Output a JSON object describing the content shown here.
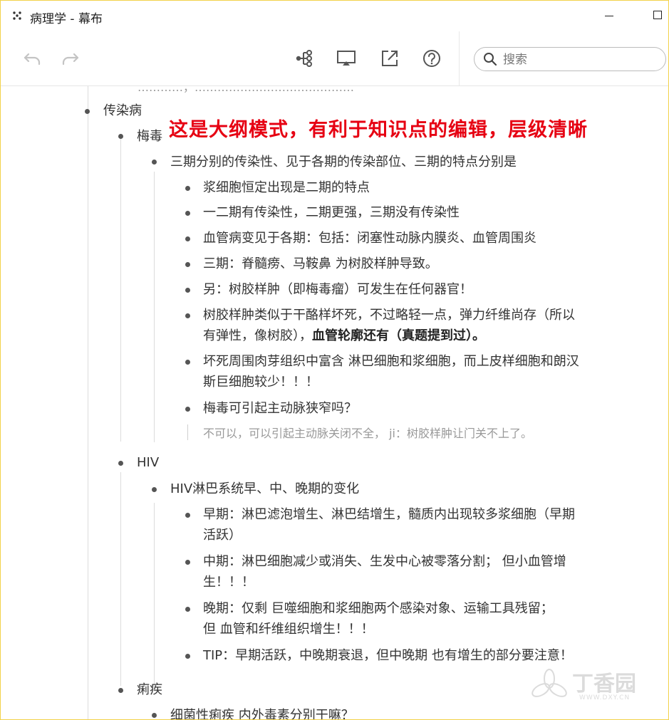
{
  "window": {
    "title": "病理学 - 幕布"
  },
  "search": {
    "placeholder": "搜索"
  },
  "annotation": "这是大纲模式，有利于知识点的编辑，层级清晰",
  "cut_text": "…………，……………………………………",
  "outline": {
    "l1": "传染病",
    "syphilis": {
      "label": "梅毒",
      "q": "三期分别的传染性、见于各期的传染部位、三期的特点分别是",
      "items": [
        "浆细胞恒定出现是二期的特点",
        "一二期有传染性，二期更强，三期没有传染性",
        "血管病变见于各期：包括：闭塞性动脉内膜炎、血管周围炎",
        "三期：脊髓痨、马鞍鼻  为树胶样肿导致。",
        "另：树胶样肿（即梅毒瘤）可发生在任何器官！"
      ],
      "item6_line1": "树胶样肿类似于干酪样坏死，不过略轻一点，弹力纤维尚存（所以",
      "item6_line2a": "有弹性，像树胶），",
      "item6_line2b": "血管轮廓还有（真题提到过）。",
      "item7_line1": "坏死周围肉芽组织中富含  淋巴细胞和浆细胞，而上皮样细胞和朗汉",
      "item7_line2": "斯巨细胞较少！！！",
      "item8": "梅毒可引起主动脉狭窄吗？",
      "note": "不可以，可以引起主动脉关闭不全， ji：树胶样肿让门关不上了。"
    },
    "hiv": {
      "label": "HIV",
      "q": "HIV淋巴系统早、中、晚期的变化",
      "early_1": "早期：淋巴滤泡增生、淋巴结增生，髓质内出现较多浆细胞（早期",
      "early_2": "活跃）",
      "mid_1": "中期：淋巴细胞减少或消失、生发中心被零落分割；    但小血管增",
      "mid_2": "生！！！",
      "late_1": "晚期：仅剩 巨噬细胞和浆细胞两个感染对象、运输工具残留；",
      "late_2": "但 血管和纤维组织增生！！！",
      "tip": "TIP：早期活跃，中晚期衰退，但中晚期 也有增生的部分要注意！"
    },
    "dysentery": {
      "label": "痢疾",
      "q": "细菌性痢疾 内外毒素分别干嘛？"
    }
  },
  "watermark": {
    "name": "丁香园",
    "url": "WWW.DXY.CN"
  }
}
